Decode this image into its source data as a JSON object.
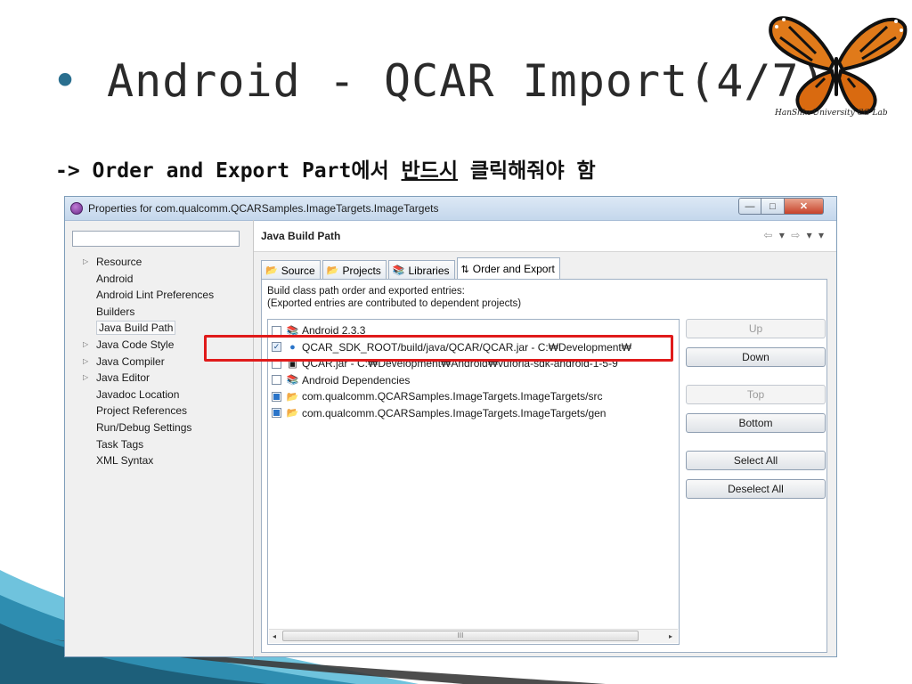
{
  "slide": {
    "title": "Android - QCAR Import(4/7)",
    "bullet": "•",
    "logo_caption": "HanShin University CG Lab",
    "subtitle_prefix": "-> Order and Export Part에서 ",
    "subtitle_emph": "반드시",
    "subtitle_suffix": " 클릭해줘야 함"
  },
  "window": {
    "title": "Properties for com.qualcomm.QCARSamples.ImageTargets.ImageTargets",
    "buttons": {
      "minimize": "—",
      "maximize": "□",
      "close": "✕"
    }
  },
  "left_tree": {
    "filter_value": "",
    "items": [
      {
        "label": "Resource",
        "expandable": true
      },
      {
        "label": "Android",
        "expandable": false
      },
      {
        "label": "Android Lint Preferences",
        "expandable": false
      },
      {
        "label": "Builders",
        "expandable": false
      },
      {
        "label": "Java Build Path",
        "expandable": false,
        "selected": true
      },
      {
        "label": "Java Code Style",
        "expandable": true
      },
      {
        "label": "Java Compiler",
        "expandable": true
      },
      {
        "label": "Java Editor",
        "expandable": true
      },
      {
        "label": "Javadoc Location",
        "expandable": false
      },
      {
        "label": "Project References",
        "expandable": false
      },
      {
        "label": "Run/Debug Settings",
        "expandable": false
      },
      {
        "label": "Task Tags",
        "expandable": false
      },
      {
        "label": "XML Syntax",
        "expandable": false
      }
    ]
  },
  "panel": {
    "title": "Java Build Path",
    "nav": {
      "back": "⇦",
      "forward": "⇨",
      "dropdown": "▾"
    },
    "tabs": [
      {
        "label": "Source",
        "icon": "source-folder-icon",
        "glyph": "📂",
        "active": false
      },
      {
        "label": "Projects",
        "icon": "projects-folder-icon",
        "glyph": "📂",
        "active": false
      },
      {
        "label": "Libraries",
        "icon": "libraries-icon",
        "glyph": "📚",
        "active": false
      },
      {
        "label": "Order and Export",
        "icon": "order-export-icon",
        "glyph": "⇅",
        "active": true
      }
    ],
    "description_line1": "Build class path order and exported entries:",
    "description_line2": "(Exported entries are contributed to dependent projects)",
    "entries": [
      {
        "label": "Android 2.3.3",
        "check": "off",
        "icon": "library-icon",
        "glyph": "📚"
      },
      {
        "label": "QCAR_SDK_ROOT/build/java/QCAR/QCAR.jar - C:₩Development₩",
        "check": "checked",
        "icon": "variable-icon",
        "glyph": "●"
      },
      {
        "label": "QCAR.jar - C:₩Development₩Android₩vuforia-sdk-android-1-5-9",
        "check": "off",
        "icon": "jar-icon",
        "glyph": "▣"
      },
      {
        "label": "Android Dependencies",
        "check": "off",
        "icon": "library-icon",
        "glyph": "📚"
      },
      {
        "label": "com.qualcomm.QCARSamples.ImageTargets.ImageTargets/src",
        "check": "full",
        "icon": "source-folder-icon",
        "glyph": "📂"
      },
      {
        "label": "com.qualcomm.QCARSamples.ImageTargets.ImageTargets/gen",
        "check": "full",
        "icon": "source-folder-icon",
        "glyph": "📂"
      }
    ],
    "scroll_left": "◂",
    "scroll_right": "▸",
    "scroll_grip": "III",
    "buttons": [
      {
        "label": "Up",
        "enabled": false
      },
      {
        "label": "Down",
        "enabled": true
      },
      {
        "label": "Top",
        "enabled": false
      },
      {
        "label": "Bottom",
        "enabled": true
      },
      {
        "label": "Select All",
        "enabled": true
      },
      {
        "label": "Deselect All",
        "enabled": true
      }
    ]
  },
  "colors": {
    "highlight": "#e01b1b",
    "title_accent": "#2a6f8f",
    "swoosh_dark": "#1d5f7a",
    "swoosh_light": "#6fc3dd"
  }
}
